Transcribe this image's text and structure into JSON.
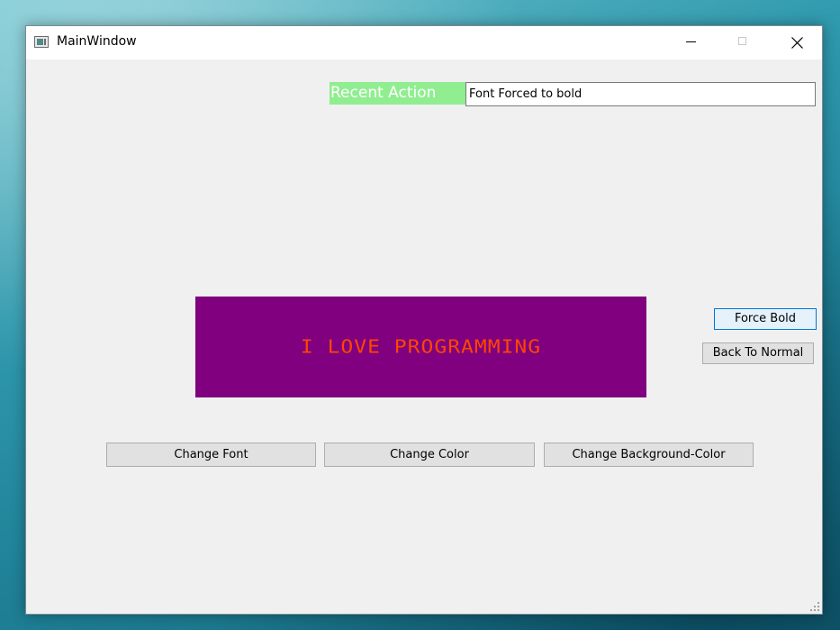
{
  "window": {
    "title": "MainWindow",
    "icons": {
      "app": "app-window-icon",
      "minimize": "minimize-icon",
      "maximize": "maximize-icon",
      "close": "close-icon"
    }
  },
  "recent": {
    "label": "Recent Action",
    "value": "Font Forced to bold"
  },
  "banner": {
    "text": "I LOVE PROGRAMMING",
    "background": "#800080",
    "color": "#ff4500"
  },
  "buttons": {
    "force_bold": "Force Bold",
    "back_to_normal": "Back To Normal",
    "change_font": "Change Font",
    "change_color": "Change Color",
    "change_background": "Change Background-Color"
  },
  "colors": {
    "label_background": "#90ee90",
    "focus_border": "#0078d7"
  }
}
